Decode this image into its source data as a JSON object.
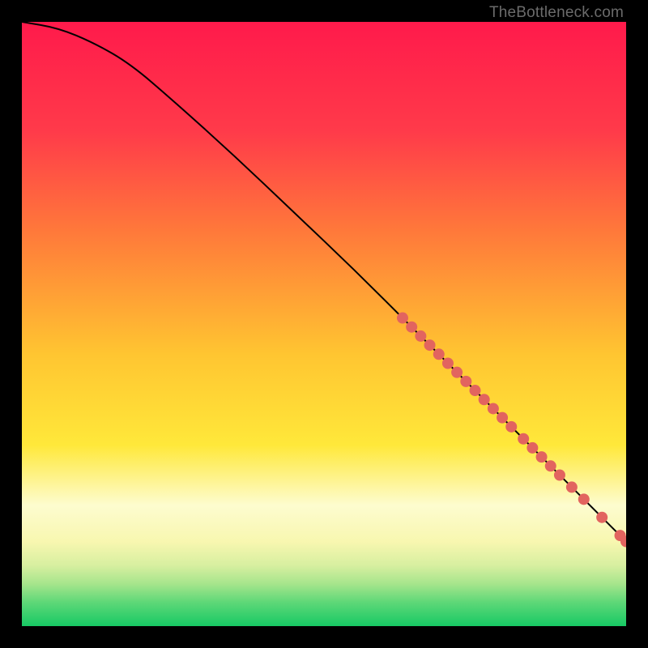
{
  "watermark": "TheBottleneck.com",
  "chart_data": {
    "type": "line",
    "title": "",
    "xlabel": "",
    "ylabel": "",
    "xlim": [
      0,
      100
    ],
    "ylim": [
      0,
      100
    ],
    "gradient_stops": [
      {
        "offset": 0,
        "color": "#ff1a4b"
      },
      {
        "offset": 18,
        "color": "#ff3a4a"
      },
      {
        "offset": 35,
        "color": "#ff7a3a"
      },
      {
        "offset": 55,
        "color": "#ffc531"
      },
      {
        "offset": 70,
        "color": "#ffe83a"
      },
      {
        "offset": 80,
        "color": "#fdfccf"
      },
      {
        "offset": 86,
        "color": "#f8f7b0"
      },
      {
        "offset": 90,
        "color": "#d7efa0"
      },
      {
        "offset": 93,
        "color": "#a6e58c"
      },
      {
        "offset": 96,
        "color": "#5fd878"
      },
      {
        "offset": 100,
        "color": "#17c964"
      }
    ],
    "curve": [
      {
        "x": 0,
        "y": 100
      },
      {
        "x": 6,
        "y": 99
      },
      {
        "x": 12,
        "y": 96.5
      },
      {
        "x": 18,
        "y": 93
      },
      {
        "x": 25,
        "y": 87
      },
      {
        "x": 35,
        "y": 78
      },
      {
        "x": 45,
        "y": 68.5
      },
      {
        "x": 55,
        "y": 59
      },
      {
        "x": 65,
        "y": 49
      },
      {
        "x": 75,
        "y": 39
      },
      {
        "x": 85,
        "y": 29
      },
      {
        "x": 95,
        "y": 19
      },
      {
        "x": 100,
        "y": 14
      }
    ],
    "points": [
      {
        "x": 63,
        "y": 51
      },
      {
        "x": 64.5,
        "y": 49.5
      },
      {
        "x": 66,
        "y": 48
      },
      {
        "x": 67.5,
        "y": 46.5
      },
      {
        "x": 69,
        "y": 45
      },
      {
        "x": 70.5,
        "y": 43.5
      },
      {
        "x": 72,
        "y": 42
      },
      {
        "x": 73.5,
        "y": 40.5
      },
      {
        "x": 75,
        "y": 39
      },
      {
        "x": 76.5,
        "y": 37.5
      },
      {
        "x": 78,
        "y": 36
      },
      {
        "x": 79.5,
        "y": 34.5
      },
      {
        "x": 81,
        "y": 33
      },
      {
        "x": 83,
        "y": 31
      },
      {
        "x": 84.5,
        "y": 29.5
      },
      {
        "x": 86,
        "y": 28
      },
      {
        "x": 87.5,
        "y": 26.5
      },
      {
        "x": 89,
        "y": 25
      },
      {
        "x": 91,
        "y": 23
      },
      {
        "x": 93,
        "y": 21
      },
      {
        "x": 96,
        "y": 18
      },
      {
        "x": 99,
        "y": 15
      },
      {
        "x": 100,
        "y": 14
      }
    ],
    "point_color": "#e2645f",
    "point_radius": 7,
    "curve_color": "#000000",
    "curve_width": 2
  }
}
